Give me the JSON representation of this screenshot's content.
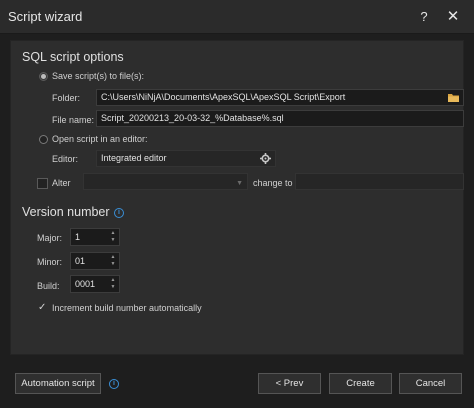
{
  "window": {
    "title": "Script wizard",
    "help_glyph": "?",
    "close_glyph": "✕"
  },
  "sql_options": {
    "title": "SQL script options",
    "save_label": "Save script(s) to file(s):",
    "folder_label": "Folder:",
    "folder_value": "C:\\Users\\NiNjA\\Documents\\ApexSQL\\ApexSQL Script\\Export",
    "filename_label": "File name:",
    "filename_value": "Script_20200213_20-03-32_%Database%.sql",
    "open_editor_label": "Open script in an editor:",
    "editor_label": "Editor:",
    "editor_value": "Integrated editor",
    "alter_label": "Alter",
    "alter_value": "",
    "change_to_label": "change to",
    "change_to_value": ""
  },
  "version": {
    "title": "Version number",
    "major_label": "Major:",
    "major_value": "1",
    "minor_label": "Minor:",
    "minor_value": "01",
    "build_label": "Build:",
    "build_value": "0001",
    "increment_label": "Increment build number automatically"
  },
  "footer": {
    "automation_label": "Automation script",
    "prev_label": "< Prev",
    "create_label": "Create",
    "cancel_label": "Cancel"
  },
  "colors": {
    "accent": "#3a8fd6",
    "folder_icon": "#d9a441"
  },
  "icons": [
    "help-icon",
    "close-icon",
    "folder-icon",
    "gear-icon",
    "info-icon",
    "checkmark-icon",
    "chevron-down-icon",
    "spin-up-icon",
    "spin-down-icon"
  ]
}
